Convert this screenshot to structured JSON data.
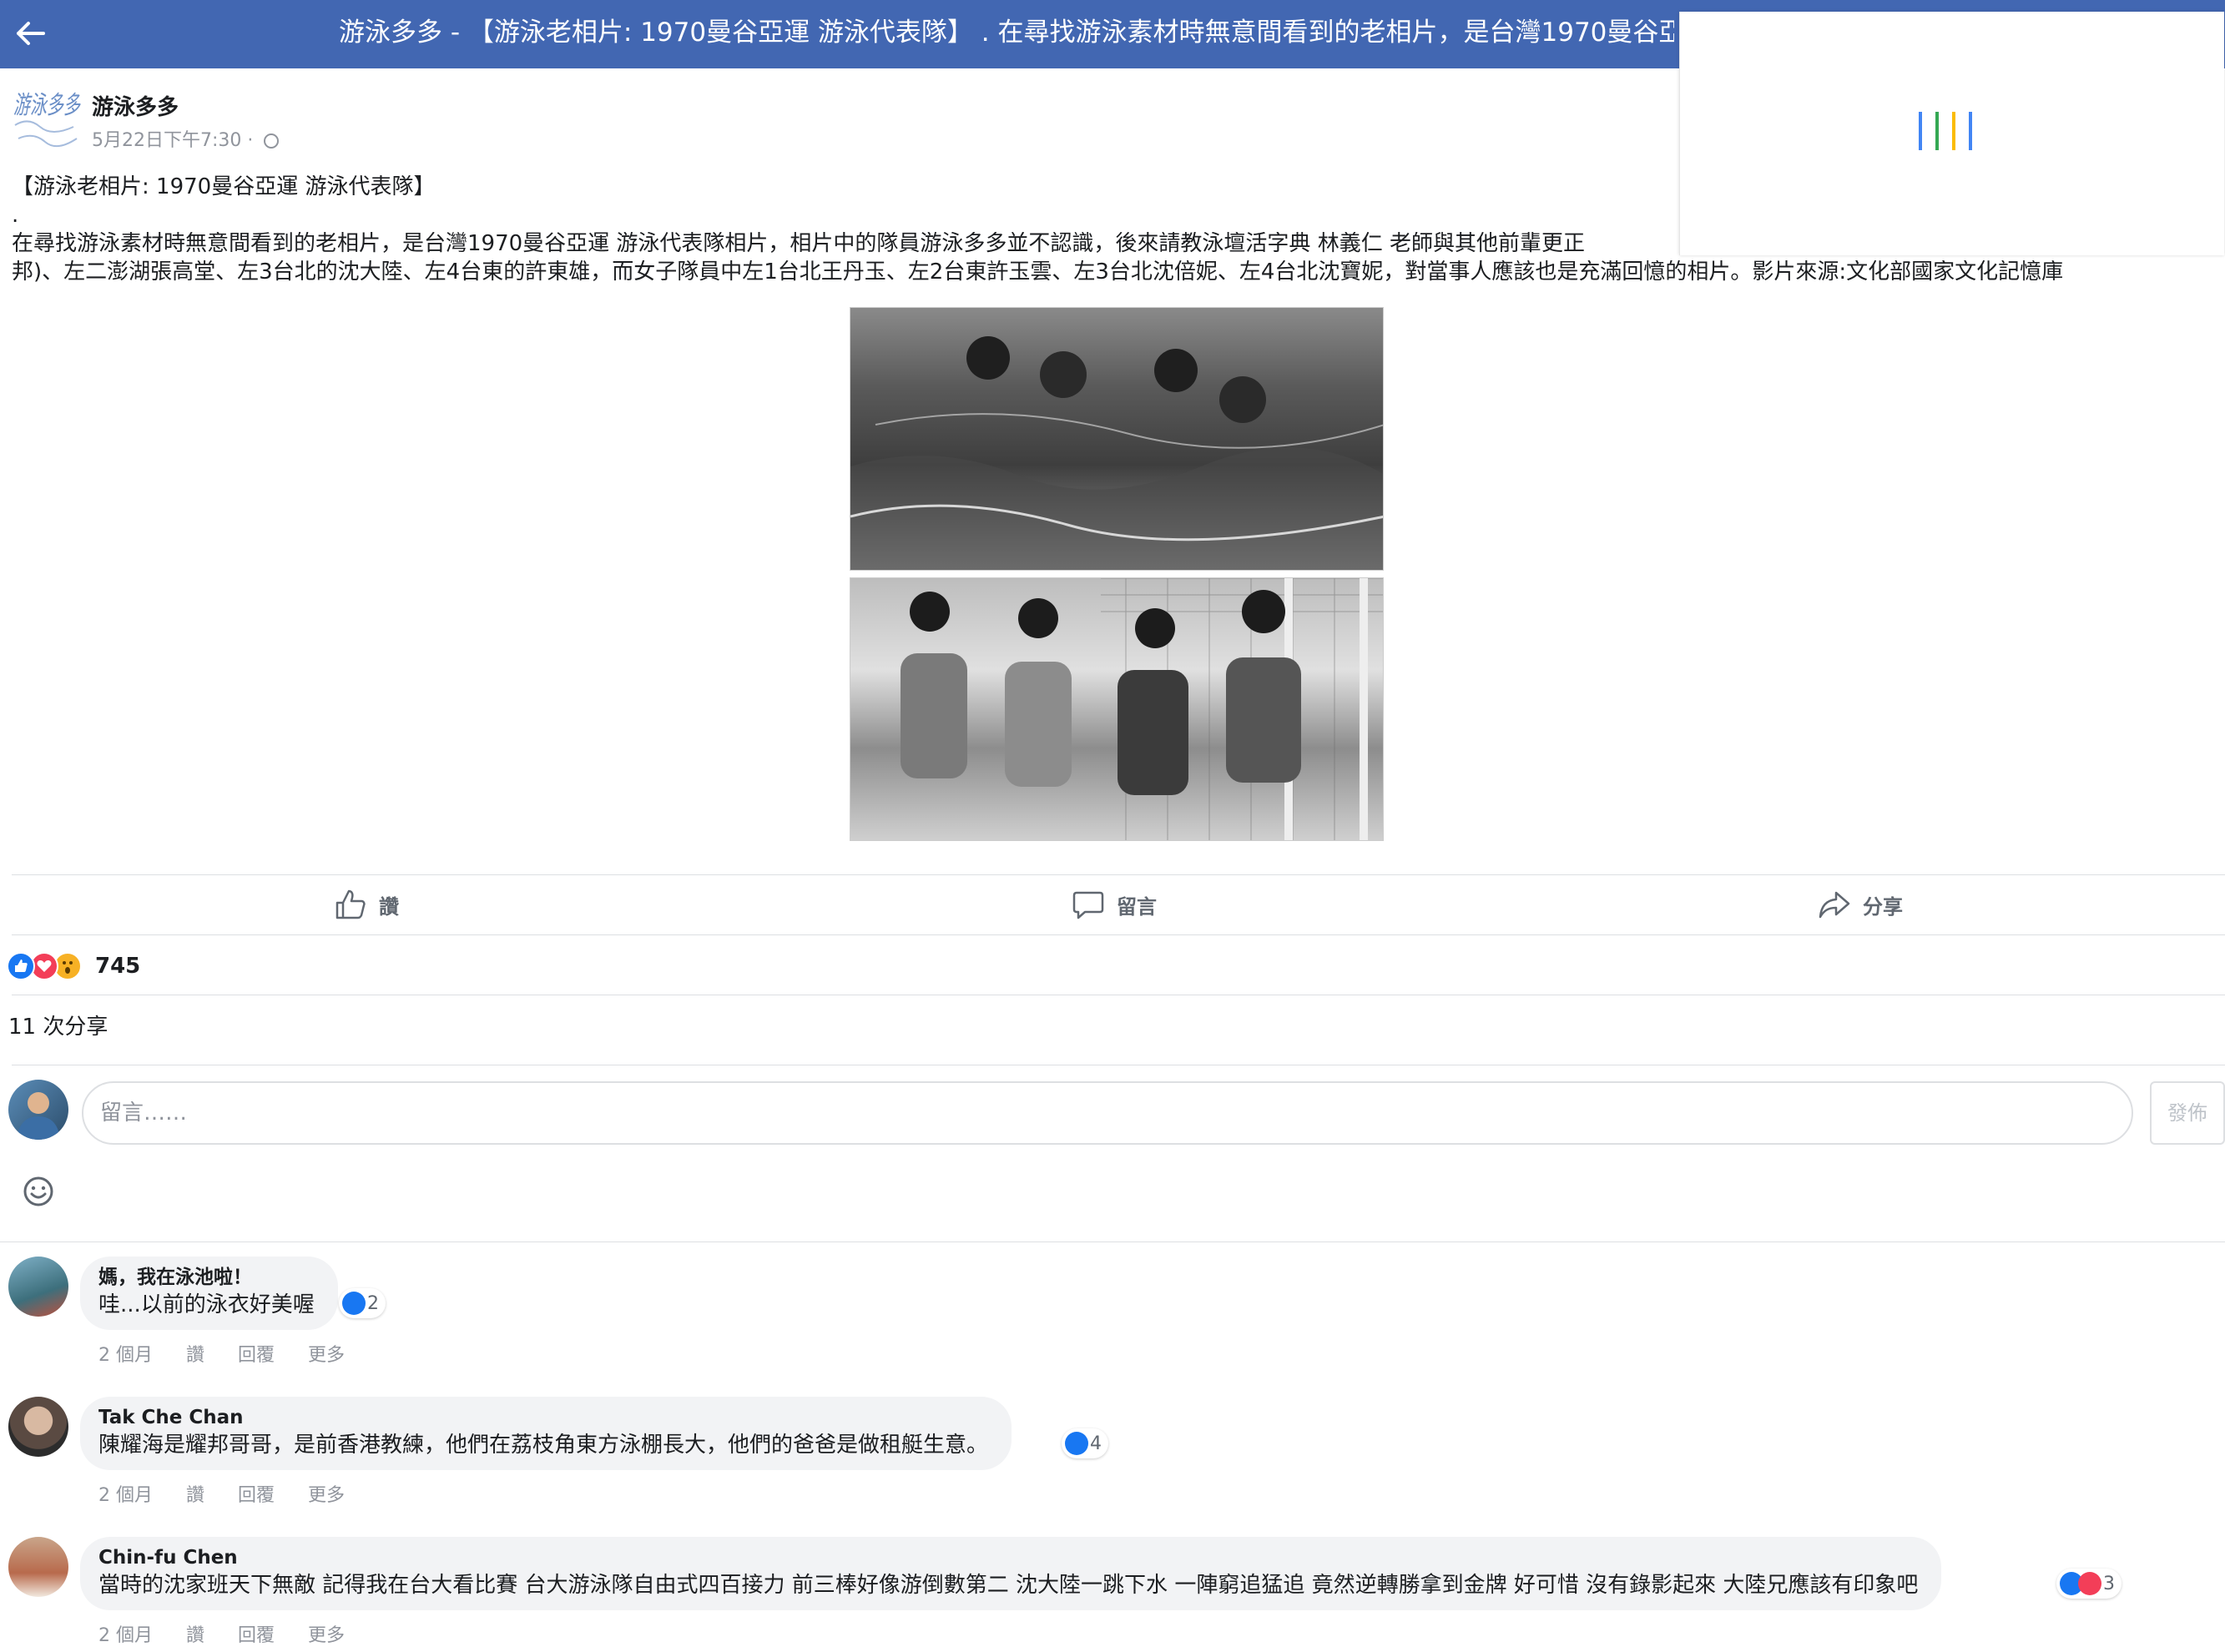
{
  "header": {
    "title": "游泳多多 - 【游泳老相片: 1970曼谷亞運 游泳代表隊】 . 在尋找游泳素材時無意間看到的老相片，是台灣1970曼谷亞"
  },
  "post": {
    "page_name": "游泳多多",
    "logo_text": "游泳多多",
    "timestamp": "5月22日下午7:30 ·",
    "lines": [
      "【游泳老相片: 1970曼谷亞運 游泳代表隊】",
      ".",
      "在尋找游泳素材時無意間看到的老相片，是台灣1970曼谷亞運 游泳代表隊相片，相片中的隊員游泳多多並不認識，後來請教泳壇活字典 林義仁 老師與其他前輩更正",
      "邦)、左二澎湖張高堂、左3台北的沈大陸、左4台東的許東雄，而女子隊員中左1台北王丹玉、左2台東許玉雲、左3台北沈倍妮、左4台北沈寶妮，對當事人應該也是充滿回憶的相片。影片來源:文化部國家文化記憶庫"
    ]
  },
  "actions": {
    "like": "讚",
    "comment": "留言",
    "share": "分享"
  },
  "stats": {
    "reaction_count": "745",
    "shares": "11 次分享"
  },
  "composer": {
    "placeholder": "留言……",
    "post_button": "發佈"
  },
  "comments": [
    {
      "author": "媽，我在泳池啦！",
      "text": "哇...以前的泳衣好美喔",
      "likes": "2",
      "time": "2 個月",
      "like": "讚",
      "reply": "回覆",
      "more": "更多"
    },
    {
      "author": "Tak Che Chan",
      "text": "陳耀海是耀邦哥哥，是前香港教練，他們在荔枝角東方泳棚長大，他們的爸爸是做租艇生意。",
      "likes": "4",
      "time": "2 個月",
      "like": "讚",
      "reply": "回覆",
      "more": "更多"
    },
    {
      "author": "Chin-fu Chen",
      "text": "當時的沈家班天下無敵 記得我在台大看比賽 台大游泳隊自由式四百接力 前三棒好像游倒數第二 沈大陸一跳下水 一陣窮追猛追 竟然逆轉勝拿到金牌 好可惜 沒有錄影起來 大陸兄應該有印象吧",
      "likes": "3",
      "time": "2 個月",
      "like": "讚",
      "reply": "回覆",
      "more": "更多"
    }
  ],
  "colors": {
    "header_bg": "#4267b2",
    "like_blue": "#1877f2",
    "love_red": "#f33e58",
    "wow_yellow": "#f7b125"
  }
}
